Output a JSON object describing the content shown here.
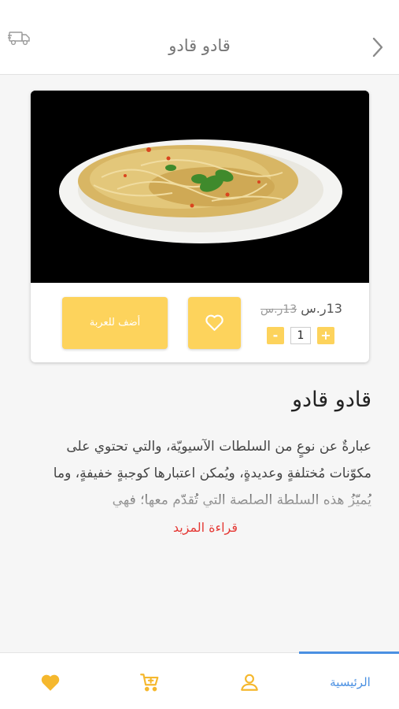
{
  "header": {
    "title": "قادو قادو",
    "left_icon": "delivery-truck-icon",
    "right_icon": "chevron-right-icon"
  },
  "product": {
    "image": "noodles-plate",
    "price": "13ر.س",
    "old_price": "13ر.س",
    "quantity": "1",
    "minus_label": "-",
    "plus_label": "+",
    "add_to_cart_label": "أضف للعربة",
    "favorite_icon": "heart-outline-icon",
    "name": "قادو قادو",
    "description": "عبارةٌ عن نوعٍ من السلطات الآسيويّة، والتي تحتوي على مكوّنات مُختلفةٍ وعديدةٍ، ويُمكن اعتبارها كوجبةٍ خفيفةٍ، وما يُميّزُ هذه السلطة الصلصة التي تُقدّم معها؛ فهي",
    "read_more_label": "قراءة المزيد"
  },
  "bottom_nav": {
    "home_label": "الرئيسية",
    "items": [
      {
        "icon": "heart-icon",
        "color": "#f5b82e"
      },
      {
        "icon": "cart-icon",
        "color": "#f5b82e"
      },
      {
        "icon": "user-icon",
        "color": "#f5b82e"
      }
    ],
    "active_color": "#4a90e2"
  },
  "colors": {
    "accent": "#fdd35c",
    "link": "#e53935",
    "nav_active": "#4a90e2"
  }
}
